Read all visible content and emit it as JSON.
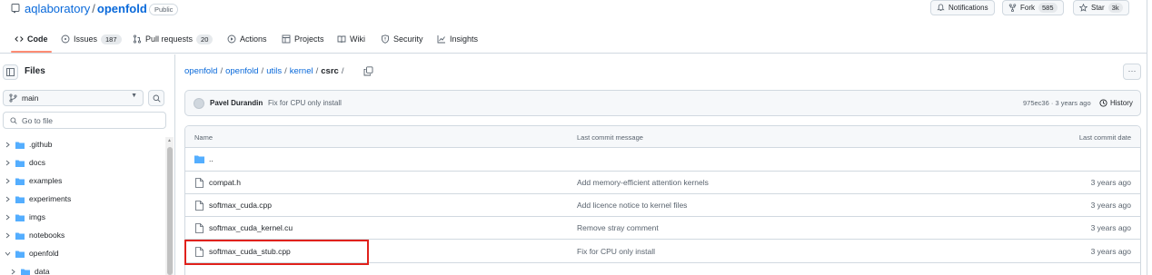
{
  "header": {
    "owner": "aqlaboratory",
    "separator": "/",
    "repo": "openfold",
    "visibility": "Public",
    "notifications_label": "Notifications",
    "fork_label": "Fork",
    "fork_count": "585",
    "star_label": "Star",
    "star_count": "3k"
  },
  "tabs": [
    {
      "label": "Code",
      "icon": "code-icon",
      "count": null,
      "active": true
    },
    {
      "label": "Issues",
      "icon": "issue-icon",
      "count": "187"
    },
    {
      "label": "Pull requests",
      "icon": "pull-request-icon",
      "count": "20"
    },
    {
      "label": "Actions",
      "icon": "play-icon",
      "count": null
    },
    {
      "label": "Projects",
      "icon": "table-icon",
      "count": null
    },
    {
      "label": "Wiki",
      "icon": "book-icon",
      "count": null
    },
    {
      "label": "Security",
      "icon": "shield-icon",
      "count": null
    },
    {
      "label": "Insights",
      "icon": "graph-icon",
      "count": null
    }
  ],
  "sidebar": {
    "title": "Files",
    "branch": "main",
    "goto_placeholder": "Go to file",
    "items": [
      {
        "label": ".github",
        "expanded": false
      },
      {
        "label": "docs",
        "expanded": false
      },
      {
        "label": "examples",
        "expanded": false
      },
      {
        "label": "experiments",
        "expanded": false
      },
      {
        "label": "imgs",
        "expanded": false
      },
      {
        "label": "notebooks",
        "expanded": false
      },
      {
        "label": "openfold",
        "expanded": true
      },
      {
        "label": "data",
        "expanded": false
      }
    ]
  },
  "breadcrumb": {
    "parts": [
      "openfold",
      "openfold",
      "utils",
      "kernel"
    ],
    "current": "csrc",
    "sep": "/"
  },
  "commit": {
    "author": "Pavel Durandin",
    "message": "Fix for CPU only install",
    "hash_time": "975ec36 · 3 years ago",
    "history_label": "History",
    "more_label": "···"
  },
  "table": {
    "col_name": "Name",
    "col_msg": "Last commit message",
    "col_date": "Last commit date",
    "parent_dir": "..",
    "rows": [
      {
        "name": "compat.h",
        "message": "Add memory-efficient attention kernels",
        "date": "3 years ago"
      },
      {
        "name": "softmax_cuda.cpp",
        "message": "Add licence notice to kernel files",
        "date": "3 years ago"
      },
      {
        "name": "softmax_cuda_kernel.cu",
        "message": "Remove stray comment",
        "date": "3 years ago"
      },
      {
        "name": "softmax_cuda_stub.cpp",
        "message": "Fix for CPU only install",
        "date": "3 years ago"
      }
    ]
  },
  "colors": {
    "link": "#0969da",
    "folder": "#54aeff",
    "highlight": "#e0211b",
    "tab_underline": "#fd8c73"
  }
}
